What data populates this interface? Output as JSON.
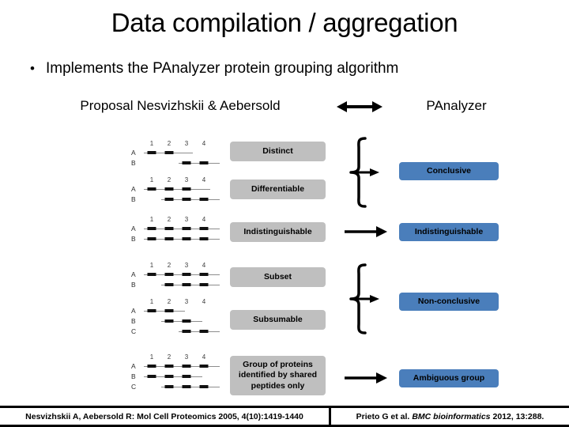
{
  "slide": {
    "title": "Data compilation / aggregation",
    "bullet_marker": "•",
    "bullet_text": "Implements the PAnalyzer protein grouping algorithm"
  },
  "columns": {
    "left_header": "Proposal Nesvizhskii & Aebersold",
    "right_header": "PAnalyzer"
  },
  "colors": {
    "grey_box": "#bfbfbf",
    "blue_box": "#4a7ebb",
    "text": "#000000",
    "background": "#ffffff",
    "evidence_line": "#8d8d8d",
    "evidence_segment": "#111111"
  },
  "icons": {
    "double_arrow": "double-headed-arrow-icon",
    "right_arrow": "right-arrow-icon",
    "brace": "curly-brace-icon"
  },
  "evidence_diagrams": [
    {
      "id": "distinct",
      "peptide_numbers": [
        "1",
        "2",
        "3",
        "4"
      ],
      "proteins": [
        {
          "label": "A",
          "peptides": [
            1,
            2
          ]
        },
        {
          "label": "B",
          "peptides": [
            3,
            4
          ]
        }
      ]
    },
    {
      "id": "differentiable",
      "peptide_numbers": [
        "1",
        "2",
        "3",
        "4"
      ],
      "proteins": [
        {
          "label": "A",
          "peptides": [
            1,
            2,
            3
          ]
        },
        {
          "label": "B",
          "peptides": [
            2,
            3,
            4
          ]
        }
      ]
    },
    {
      "id": "indistinguishable",
      "peptide_numbers": [
        "1",
        "2",
        "3",
        "4"
      ],
      "proteins": [
        {
          "label": "A",
          "peptides": [
            1,
            2,
            3,
            4
          ]
        },
        {
          "label": "B",
          "peptides": [
            1,
            2,
            3,
            4
          ]
        }
      ]
    },
    {
      "id": "subset",
      "peptide_numbers": [
        "1",
        "2",
        "3",
        "4"
      ],
      "proteins": [
        {
          "label": "A",
          "peptides": [
            1,
            2,
            3,
            4
          ]
        },
        {
          "label": "B",
          "peptides": [
            2,
            3,
            4
          ]
        }
      ]
    },
    {
      "id": "subsumable",
      "peptide_numbers": [
        "1",
        "2",
        "3",
        "4"
      ],
      "proteins": [
        {
          "label": "A",
          "peptides": [
            1,
            2
          ]
        },
        {
          "label": "B",
          "peptides": [
            2,
            3
          ]
        },
        {
          "label": "C",
          "peptides": [
            3,
            4
          ]
        }
      ]
    },
    {
      "id": "group-shared-peptides",
      "peptide_numbers": [
        "1",
        "2",
        "3",
        "4"
      ],
      "proteins": [
        {
          "label": "A",
          "peptides": [
            1,
            2,
            3,
            4
          ]
        },
        {
          "label": "B",
          "peptides": [
            1,
            2,
            3
          ]
        },
        {
          "label": "C",
          "peptides": [
            2,
            3,
            4
          ]
        }
      ]
    }
  ],
  "proposal_boxes": [
    {
      "id": "distinct",
      "label": "Distinct"
    },
    {
      "id": "differentiable",
      "label": "Differentiable"
    },
    {
      "id": "indistinguishable",
      "label": "Indistinguishable"
    },
    {
      "id": "subset",
      "label": "Subset"
    },
    {
      "id": "subsumable",
      "label": "Subsumable"
    },
    {
      "id": "group-shared",
      "label": "Group of proteins identified by shared peptides only"
    }
  ],
  "panalyzer_boxes": [
    {
      "id": "conclusive",
      "label": "Conclusive"
    },
    {
      "id": "indistinguishable",
      "label": "Indistinguishable"
    },
    {
      "id": "non-conclusive",
      "label": "Non-conclusive"
    },
    {
      "id": "ambiguous-group",
      "label": "Ambiguous group"
    }
  ],
  "footer": {
    "left_citation": "Nesvizhskii A, Aebersold R: Mol Cell Proteomics 2005, 4(10):1419-1440",
    "right_citation_lead": "Prieto G et al.",
    "right_citation_journal": "BMC bioinformatics",
    "right_citation_tail": "2012, 13:288."
  }
}
